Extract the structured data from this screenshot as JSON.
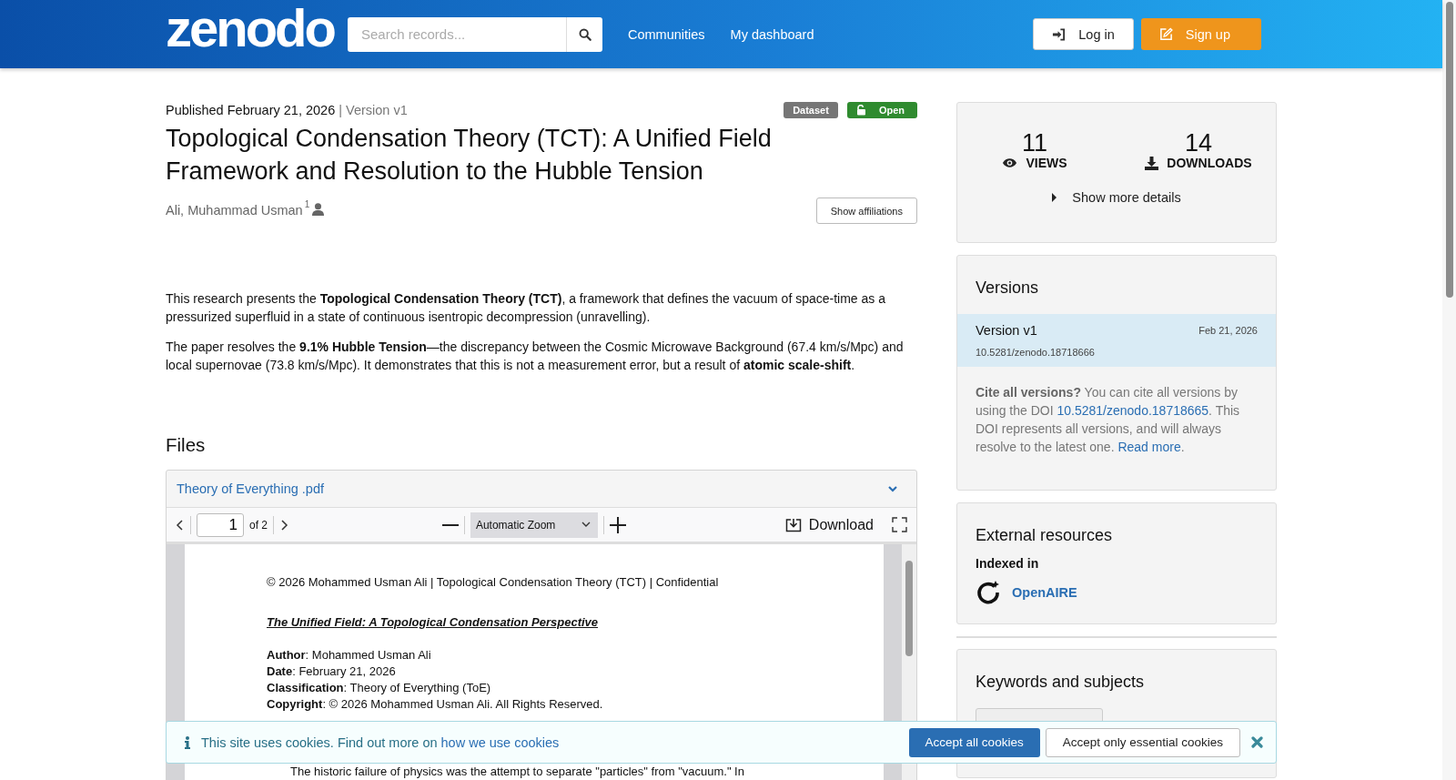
{
  "header": {
    "logo": "zenodo",
    "search": {
      "placeholder": "Search records..."
    },
    "nav": [
      "Communities",
      "My dashboard"
    ],
    "login": "Log in",
    "signup": "Sign up"
  },
  "record": {
    "published": "Published February 21, 2026",
    "version": "| Version v1",
    "badges": [
      {
        "label": "Dataset",
        "kind": "type"
      },
      {
        "label": "Open",
        "kind": "access"
      }
    ],
    "title": "Topological Condensation Theory (TCT): A Unified Field Framework and Resolution to the Hubble Tension",
    "creators": [
      {
        "name": "Ali, Muhammad Usman",
        "affiliation": "1"
      }
    ],
    "show_affiliations": "Show affiliations",
    "abstract": [
      "This research presents the **Topological Condensation Theory (TCT)**, a framework that defines the vacuum of space-time as a pressurized superfluid in a state of continuous isentropic decompression (unravelling).",
      "The paper resolves the **9.1% Hubble Tension**—the discrepancy between the Cosmic Microwave Background (67.4 km/s/Mpc) and local supernovae (73.8 km/s/Mpc). It demonstrates that this is not a measurement error, but a result of **atomic scale-shift**."
    ]
  },
  "files": {
    "heading": "Files",
    "file_name": "Theory of Everything .pdf",
    "page": "1",
    "page_count": "of 2",
    "zoom": "Automatic Zoom",
    "download": "Download",
    "pdf_lines": [
      {
        "kind": "header",
        "text": "© 2026 Mohammed Usman Ali | Topological Condensation Theory (TCT) | Confidential"
      },
      {
        "kind": "title",
        "text": "The Unified Field: A Topological Condensation Perspective"
      },
      {
        "kind": "field",
        "text": "**Author**: Mohammed Usman Ali"
      },
      {
        "kind": "field",
        "text": "**Date**: February 21, 2026"
      },
      {
        "kind": "field",
        "text": "**Classification**: Theory of Everything (ToE)"
      },
      {
        "kind": "field",
        "text": "**Copyright**: © 2026 Mohammed Usman Ali. All Rights Reserved."
      },
      {
        "kind": "body",
        "text": "The historic failure of physics was the attempt to separate \"particles\" from \"vacuum.\" In"
      }
    ]
  },
  "stats": {
    "items": [
      {
        "value": "11",
        "label": "VIEWS",
        "kind": "views"
      },
      {
        "value": "14",
        "label": "DOWNLOADS",
        "kind": "downloads"
      }
    ],
    "more": "Show more details"
  },
  "versions": {
    "heading": "Versions",
    "items": [
      {
        "title": "Version v1",
        "date": "Feb 21, 2026",
        "doi": "10.5281/zenodo.18718666",
        "selected": true
      }
    ],
    "cite": [
      {
        "kind": "text",
        "text": "**Cite all versions?** You can cite all versions by using the DOI "
      },
      {
        "kind": "link",
        "text": "10.5281/zenodo.18718665"
      },
      {
        "kind": "text",
        "text": ". This DOI represents all versions, and will always resolve to the latest one. "
      },
      {
        "kind": "link",
        "text": "Read more"
      },
      {
        "kind": "text",
        "text": "."
      }
    ]
  },
  "external": {
    "heading": "External resources",
    "subheading": "Indexed in",
    "items": [
      {
        "name": "OpenAIRE"
      }
    ]
  },
  "keywords": {
    "heading": "Keywords and subjects"
  },
  "cookies": {
    "text": "This site uses cookies. Find out more on ",
    "link": "how we use cookies",
    "accept_all": "Accept all cookies",
    "accept_essential": "Accept only essential cookies"
  }
}
